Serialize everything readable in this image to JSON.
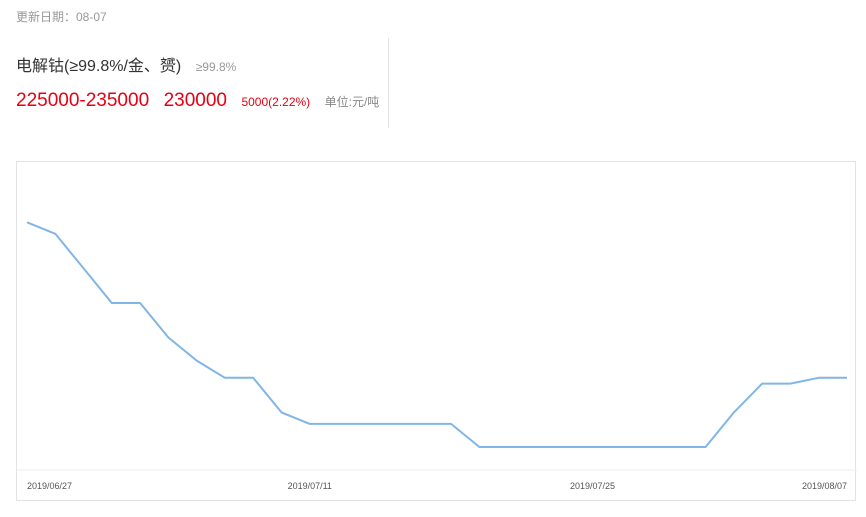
{
  "header": {
    "update_date": "更新日期：08-07"
  },
  "product": {
    "name": "电解钴(≥99.8%/金、赟)",
    "purity": "≥99.8%",
    "price_range": "225000-235000",
    "price_avg": "230000",
    "change": "5000(2.22%)",
    "unit": "单位:元/吨"
  },
  "colors": {
    "line": "#80b6e6",
    "price_red": "#e60012"
  },
  "chart_data": {
    "type": "line",
    "title": "",
    "xlabel": "",
    "ylabel": "",
    "x_ticks": [
      "2019/06/27",
      "2019/07/11",
      "2019/07/25",
      "2019/08/07"
    ],
    "x": [
      "2019/06/27",
      "2019/06/28",
      "2019/07/01",
      "2019/07/02",
      "2019/07/03",
      "2019/07/04",
      "2019/07/05",
      "2019/07/08",
      "2019/07/09",
      "2019/07/10",
      "2019/07/11",
      "2019/07/12",
      "2019/07/15",
      "2019/07/16",
      "2019/07/17",
      "2019/07/18",
      "2019/07/19",
      "2019/07/22",
      "2019/07/23",
      "2019/07/24",
      "2019/07/25",
      "2019/07/26",
      "2019/07/29",
      "2019/07/30",
      "2019/07/31",
      "2019/08/01",
      "2019/08/02",
      "2019/08/05",
      "2019/08/06",
      "2019/08/07"
    ],
    "series": [
      {
        "values": [
          283000,
          281000,
          275000,
          269000,
          269000,
          263000,
          259000,
          256000,
          256000,
          250000,
          248000,
          248000,
          248000,
          248000,
          248000,
          248000,
          244000,
          244000,
          244000,
          244000,
          244000,
          244000,
          244000,
          244000,
          244000,
          250000,
          255000,
          255000,
          256000,
          256000
        ]
      }
    ],
    "ylim": [
      240000,
      290000
    ],
    "grid": false,
    "legend": "none"
  }
}
